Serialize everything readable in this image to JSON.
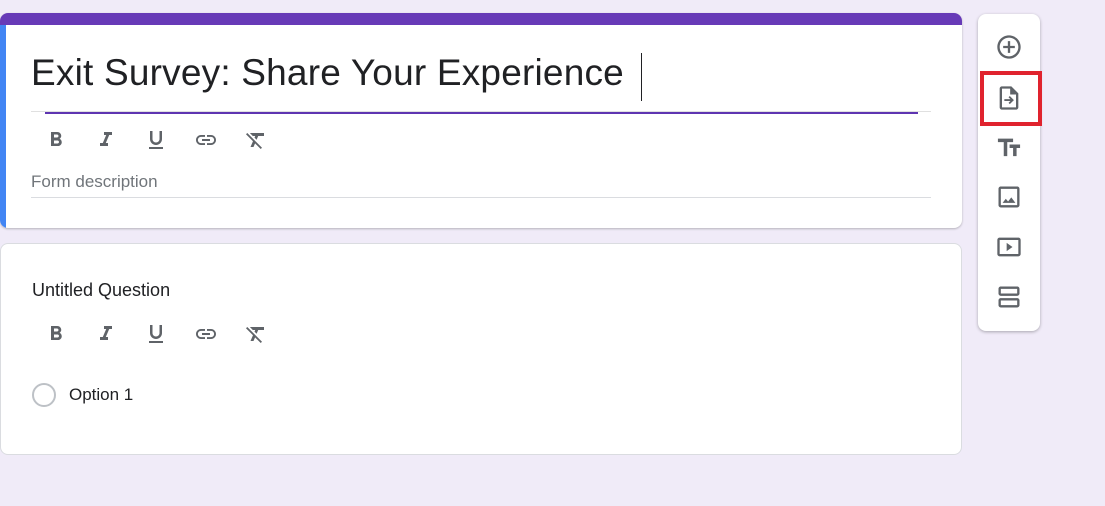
{
  "form": {
    "title": "Exit Survey: Share Your Experience",
    "description_placeholder": "Form description"
  },
  "format_toolbar": {
    "icons": [
      "bold-icon",
      "italic-icon",
      "underline-icon",
      "link-icon",
      "clear-formatting-icon"
    ]
  },
  "question": {
    "title": "Untitled Question",
    "options": [
      "Option 1"
    ]
  },
  "side_toolbar": {
    "icons": [
      "add-question-icon",
      "import-questions-icon",
      "add-title-description-icon",
      "add-image-icon",
      "add-video-icon",
      "add-section-icon"
    ],
    "highlighted": "import-questions-icon"
  },
  "colors": {
    "theme": "#673ab7",
    "accent_left": "#4285f4",
    "background": "#f0ebf8",
    "highlight": "#e0232e"
  }
}
